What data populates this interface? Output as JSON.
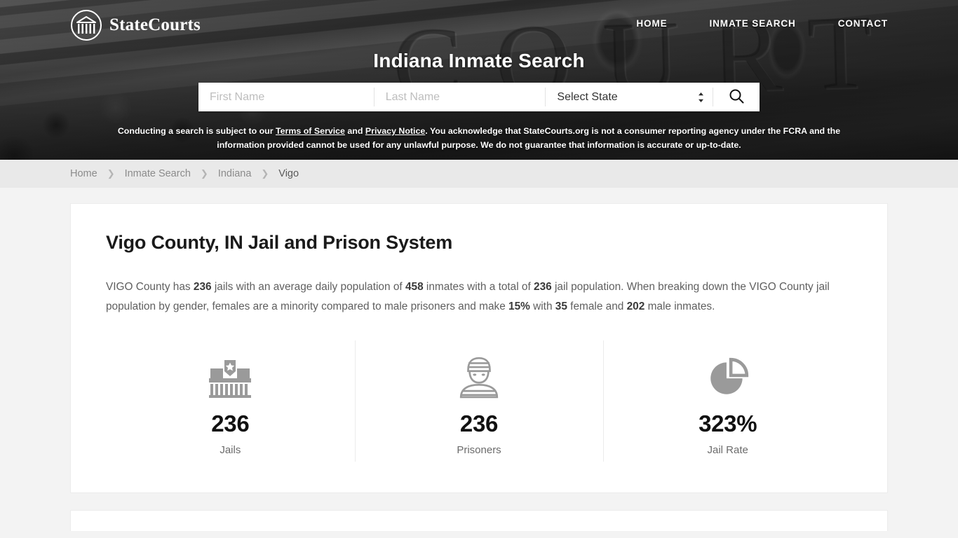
{
  "header": {
    "logo_text": "StateCourts",
    "logo_icon": "courthouse-circle-logo",
    "nav": [
      {
        "label": "HOME",
        "name": "home"
      },
      {
        "label": "INMATE SEARCH",
        "name": "inmate-search"
      },
      {
        "label": "CONTACT",
        "name": "contact"
      }
    ],
    "title": "Indiana Inmate Search",
    "search": {
      "first_name_placeholder": "First Name",
      "first_name_value": "",
      "last_name_placeholder": "Last Name",
      "last_name_value": "",
      "state_selected": "Select State",
      "state_options": [
        "Select State"
      ],
      "search_icon": "search-icon",
      "dropdown_icon": "spinner-arrows-icon"
    },
    "disclaimer": {
      "part1": "Conducting a search is subject to our ",
      "terms_link": "Terms of Service",
      "part2": " and ",
      "privacy_link": "Privacy Notice",
      "part3": ". You acknowledge that StateCourts.org is not a consumer reporting agency under the FCRA and the information provided cannot be used for any unlawful purpose. We do not guarantee that information is accurate or up-to-date."
    }
  },
  "breadcrumb": [
    {
      "label": "Home",
      "current": false
    },
    {
      "label": "Inmate Search",
      "current": false
    },
    {
      "label": "Indiana",
      "current": false
    },
    {
      "label": "Vigo",
      "current": true
    }
  ],
  "main": {
    "title": "Vigo County, IN Jail and Prison System",
    "paragraph": {
      "s1": "VIGO County has ",
      "b1": "236",
      "s2": " jails with an average daily population of ",
      "b2": "458",
      "s3": " inmates with a total of ",
      "b3": "236",
      "s4": " jail population. When breaking down the VIGO County jail population by gender, females are a minority compared to male prisoners and make ",
      "b4": "15%",
      "s5": " with ",
      "b5": "35",
      "s6": " female and ",
      "b6": "202",
      "s7": " male inmates."
    },
    "stats": [
      {
        "icon": "jail-building-icon",
        "value": "236",
        "label": "Jails"
      },
      {
        "icon": "prisoner-icon",
        "value": "236",
        "label": "Prisoners"
      },
      {
        "icon": "pie-chart-icon",
        "value": "323%",
        "label": "Jail Rate"
      }
    ]
  },
  "colors": {
    "page_background": "#f3f3f3",
    "breadcrumb_background": "#e9e9e9",
    "card_background": "#ffffff",
    "icon_gray": "#9a9a9a",
    "text_muted": "#6b6b6b",
    "hero_overlay": "#3b3b3b"
  }
}
